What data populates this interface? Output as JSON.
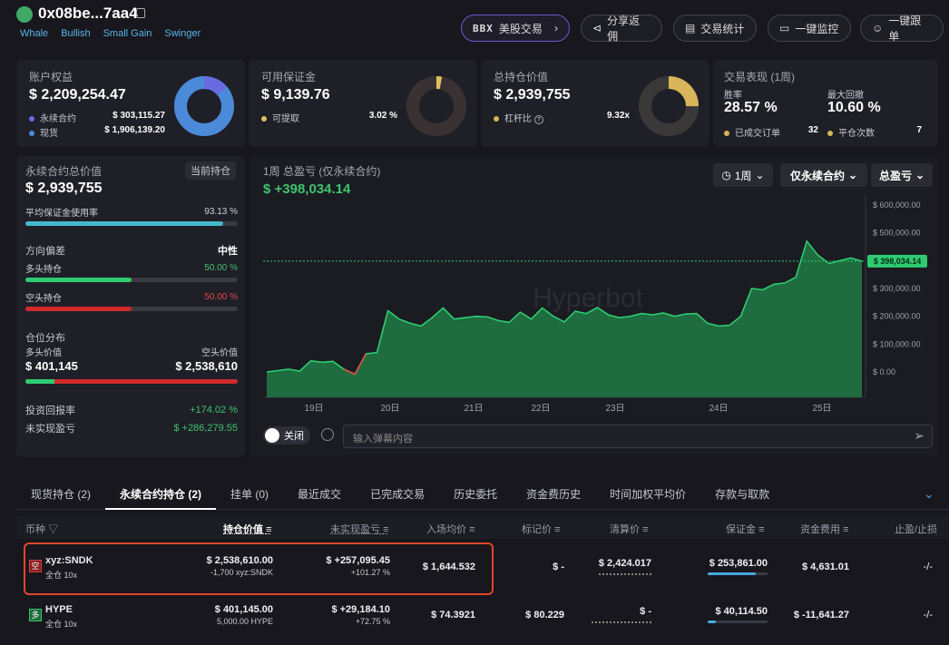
{
  "header": {
    "address": "0x08be...7aa4",
    "tags": [
      "Whale",
      "Bullish",
      "Small Gain",
      "Swinger"
    ],
    "buttons": {
      "us_stock": "美股交易",
      "us_stock_brand": "BBX",
      "share": "分享返佣",
      "stats": "交易统计",
      "monitor": "一键监控",
      "copy_trade": "一键跟单"
    }
  },
  "account": {
    "title": "账户权益",
    "value": "$ 2,209,254.47",
    "perp_label": "永续合约",
    "perp_value": "$ 303,115.27",
    "spot_label": "现货",
    "spot_value": "$ 1,906,139.20",
    "perp_fraction": 0.137,
    "colors": {
      "perp": "#6a6ae0",
      "spot": "#4a8ad8"
    }
  },
  "margin": {
    "title": "可用保证金",
    "value": "$ 9,139.76",
    "withdraw_label": "可提取",
    "withdraw_value": "3.02 %",
    "fraction": 0.0302,
    "color": "#e0c060"
  },
  "position_value": {
    "title": "总持仓价值",
    "value": "$ 2,939,755",
    "leverage_label": "杠杆比",
    "leverage_value": "9.32x",
    "fraction": 0.25,
    "color": "#d8b45a"
  },
  "performance": {
    "title": "交易表现 (1周)",
    "win_label": "胜率",
    "win_value": "28.57 %",
    "dd_label": "最大回撤",
    "dd_value": "10.60 %",
    "closed_label": "已成交订单",
    "closed_value": "32",
    "close_count_label": "平仓次数",
    "close_count_value": "7"
  },
  "perp_panel": {
    "title": "永续合约总价值",
    "current_btn": "当前持仓",
    "value": "$ 2,939,755",
    "margin_usage_label": "平均保证金使用率",
    "margin_usage_value": "93.13 %",
    "margin_usage_fraction": 0.9313,
    "direction_label": "方向偏差",
    "direction_value": "中性",
    "long_label": "多头持仓",
    "long_value": "50.00 %",
    "long_fraction": 0.5,
    "short_label": "空头持仓",
    "short_value": "50.00 %",
    "short_fraction": 0.5,
    "dist_label": "仓位分布",
    "long_val_label": "多头价值",
    "short_val_label": "空头价值",
    "long_val": "$ 401,145",
    "short_val": "$ 2,538,610",
    "long_val_fraction": 0.136,
    "roi_label": "投资回报率",
    "roi_value": "+174.02 %",
    "upnl_label": "未实现盈亏",
    "upnl_value": "$ +286,279.55"
  },
  "pnl_chart": {
    "title": "1周 总盈亏 (仅永续合约)",
    "value": "$ +398,034.14",
    "period": "1周",
    "scope": "仅永续合约",
    "metric": "总盈亏",
    "watermark": "Hyperbot",
    "close_toggle": "关闭",
    "danmu_placeholder": "输入弹幕内容"
  },
  "chart_data": {
    "type": "area",
    "title": "1周 总盈亏 (仅永续合约)",
    "x_ticks": [
      "19日",
      "20日",
      "21日",
      "22日",
      "23日",
      "24日",
      "25日"
    ],
    "y_ticks": [
      "$ 600,000.00",
      "$ 500,000.00",
      "$ 400,000.00",
      "$ 300,000.00",
      "$ 200,000.00",
      "$ 100,000.00",
      "$ 0.00"
    ],
    "ylim": [
      0,
      600000
    ],
    "current_label": "$ 398,034.14",
    "current_value": 398034,
    "values": [
      0,
      5000,
      10000,
      3000,
      40000,
      35000,
      38000,
      10000,
      -8000,
      65000,
      70000,
      220000,
      190000,
      175000,
      165000,
      195000,
      230000,
      190000,
      195000,
      200000,
      198000,
      185000,
      178000,
      215000,
      190000,
      230000,
      200000,
      180000,
      218000,
      210000,
      232000,
      205000,
      195000,
      200000,
      210000,
      205000,
      212000,
      200000,
      208000,
      210000,
      175000,
      165000,
      168000,
      200000,
      300000,
      295000,
      315000,
      320000,
      340000,
      470000,
      420000,
      390000,
      400000,
      410000,
      398000
    ],
    "grid": false,
    "colors": {
      "line": "#2ecc71",
      "neg": "#e74c3c"
    }
  },
  "tabs": [
    "现货持仓 (2)",
    "永续合约持仓 (2)",
    "挂单 (0)",
    "最近成交",
    "已完成交易",
    "历史委托",
    "资金费历史",
    "时间加权平均价",
    "存款与取款"
  ],
  "active_tab": 1,
  "table": {
    "headers": [
      "币种",
      "持仓价值",
      "未实现盈亏",
      "入场均价",
      "标记价",
      "清算价",
      "保证金",
      "资金费用",
      "止盈/止损"
    ],
    "rows": [
      {
        "side": "空",
        "side_color": "#c0392b",
        "coin": "xyz:SNDK",
        "mode": "全仓 10x",
        "value": "$ 2,538,610.00",
        "value_sub": "-1,700 xyz:SNDK",
        "upnl": "$ +257,095.45",
        "upnl_sub": "+101.27 %",
        "entry": "$ 1,644.532",
        "mark": "$ -",
        "liq": "$ 2,424.017",
        "margin": "$ 253,861.00",
        "margin_fraction": 0.8,
        "funding": "$ 4,631.01",
        "funding_pos": true,
        "tpsl": "-/-"
      },
      {
        "side": "多",
        "side_color": "#27ae60",
        "coin": "HYPE",
        "mode": "全仓 10x",
        "value": "$ 401,145.00",
        "value_sub": "5,000.00 HYPE",
        "upnl": "$ +29,184.10",
        "upnl_sub": "+72.75 %",
        "entry": "$ 74.3921",
        "mark": "$ 80.229",
        "liq": "$ -",
        "margin": "$ 40,114.50",
        "margin_fraction": 0.13,
        "funding": "$ -11,641.27",
        "funding_pos": false,
        "tpsl": "-/-"
      }
    ]
  }
}
